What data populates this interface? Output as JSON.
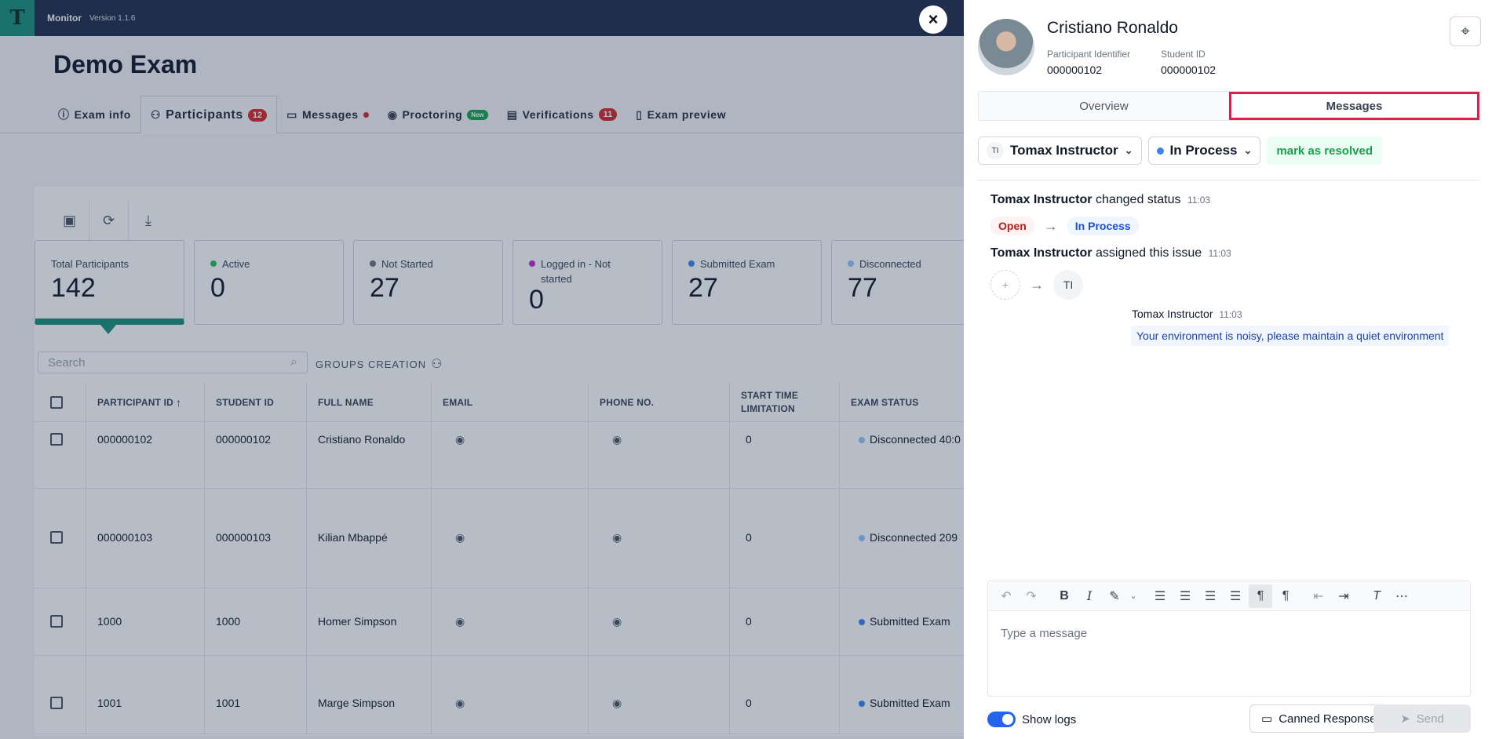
{
  "app": {
    "name": "Monitor",
    "version": "Version 1.1.6",
    "logo_icon": "graduation-cap-icon"
  },
  "page_title": "Demo Exam",
  "tabs": [
    {
      "label": "Exam info",
      "icon": "info-icon"
    },
    {
      "label": "Participants",
      "icon": "people-icon",
      "count": "12"
    },
    {
      "label": "Messages",
      "icon": "chat-icon"
    },
    {
      "label": "Proctoring",
      "icon": "eye-icon",
      "badge": "New"
    },
    {
      "label": "Verifications",
      "icon": "id-card-icon",
      "count": "11"
    },
    {
      "label": "Exam preview",
      "icon": "document-icon"
    }
  ],
  "stats": [
    {
      "label": "Total Participants",
      "value": "142"
    },
    {
      "label": "Active",
      "value": "0",
      "color": "#22c55e"
    },
    {
      "label": "Not Started",
      "value": "27",
      "color": "#6b7280"
    },
    {
      "label": "Logged in - Not started",
      "value": "0",
      "color": "#c026d3"
    },
    {
      "label": "Submitted Exam",
      "value": "27",
      "color": "#3b82f6"
    },
    {
      "label": "Disconnected",
      "value": "77",
      "color": "#93c5fd"
    }
  ],
  "search": {
    "placeholder": "Search"
  },
  "groups_label": "GROUPS CREATION",
  "table": {
    "columns": [
      "PARTICIPANT ID",
      "STUDENT ID",
      "FULL NAME",
      "EMAIL",
      "PHONE NO.",
      "START TIME LIMITATION",
      "EXAM STATUS"
    ],
    "rows": [
      {
        "participant_id": "000000102",
        "student_id": "000000102",
        "full_name": "Cristiano Ronaldo",
        "start": "0",
        "status": "Disconnected 40:0",
        "status_color": "#93c5fd"
      },
      {
        "participant_id": "000000103",
        "student_id": "000000103",
        "full_name": "Kilian Mbappé",
        "start": "0",
        "status": "Disconnected 209",
        "status_color": "#93c5fd"
      },
      {
        "participant_id": "1000",
        "student_id": "1000",
        "full_name": "Homer Simpson",
        "start": "0",
        "status": "Submitted Exam",
        "status_color": "#3b82f6"
      },
      {
        "participant_id": "1001",
        "student_id": "1001",
        "full_name": "Marge Simpson",
        "start": "0",
        "status": "Submitted Exam",
        "status_color": "#3b82f6"
      }
    ]
  },
  "panel": {
    "name": "Cristiano Ronaldo",
    "participant_identifier_label": "Participant Identifier",
    "participant_identifier": "000000102",
    "student_id_label": "Student ID",
    "student_id": "000000102",
    "seg_overview": "Overview",
    "seg_messages": "Messages",
    "assignee": "Tomax Instructor",
    "assignee_initials": "TI",
    "status": "In Process",
    "resolve": "mark as resolved",
    "log1_actor": "Tomax Instructor",
    "log1_action": "changed status",
    "log1_time": "11:03",
    "status_from": "Open",
    "status_to": "In Process",
    "log2_actor": "Tomax Instructor",
    "log2_action": "assigned this issue",
    "log2_time": "11:03",
    "assign_plus": "+",
    "assign_to": "TI",
    "msg_author": "Tomax Instructor",
    "msg_time": "11:03",
    "msg_text": "Your environment is noisy, please maintain a quiet environment",
    "editor_placeholder": "Type a message",
    "show_logs": "Show logs",
    "canned": "Canned Response",
    "send": "Send"
  }
}
